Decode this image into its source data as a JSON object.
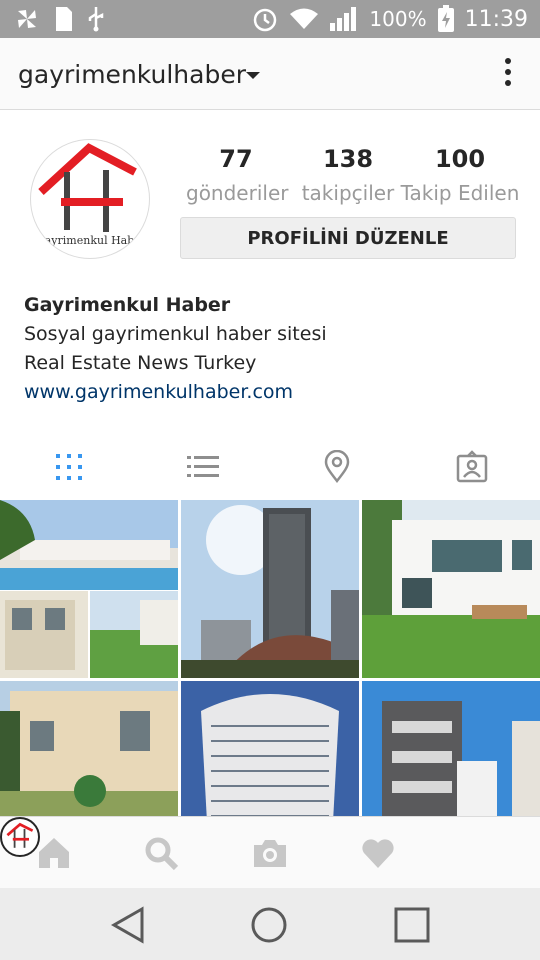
{
  "status_bar": {
    "battery": "100%",
    "time": "11:39"
  },
  "header": {
    "username": "gayrimenkulhaber"
  },
  "profile": {
    "avatar_text": "Gayrimenkul Haber",
    "stats": [
      {
        "value": "77",
        "label": "gönderiler"
      },
      {
        "value": "138",
        "label": "takipçiler"
      },
      {
        "value": "100",
        "label": "Takip Edilen"
      }
    ],
    "edit_button": "PROFİLİNİ DÜZENLE",
    "name": "Gayrimenkul Haber",
    "bio": [
      "Sosyal gayrimenkul haber sitesi",
      "Real Estate News Turkey"
    ],
    "website": "www.gayrimenkulhaber.com"
  },
  "tabs": [
    "grid-view",
    "list-view",
    "map-view",
    "tagged-view"
  ],
  "colors": {
    "status_bar": "#9e9e9e",
    "active_tab": "#3897f0",
    "inactive_icon": "#8e8e8e",
    "link": "#003569",
    "logo_red": "#e31e24"
  }
}
